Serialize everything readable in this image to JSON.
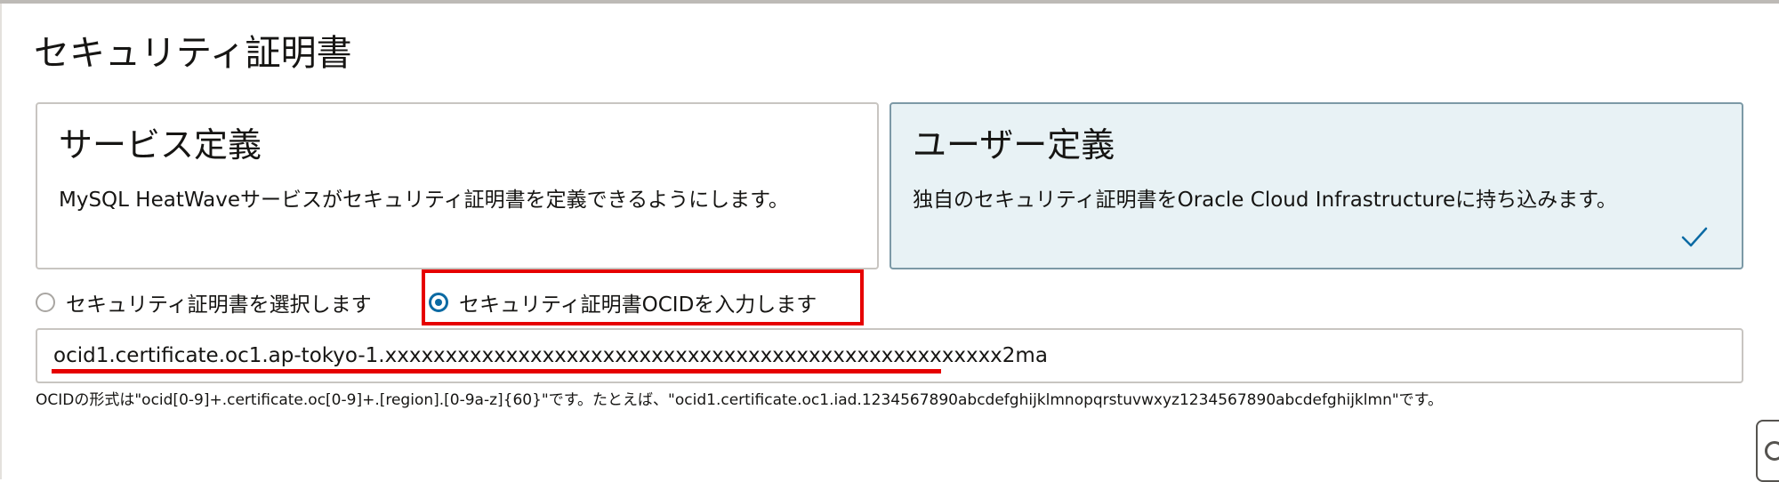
{
  "section": {
    "title": "セキュリティ証明書"
  },
  "cards": [
    {
      "title": "サービス定義",
      "description": "MySQL HeatWaveサービスがセキュリティ証明書を定義できるようにします。",
      "selected": false
    },
    {
      "title": "ユーザー定義",
      "description": "独自のセキュリティ証明書をOracle Cloud Infrastructureに持ち込みます。",
      "selected": true
    }
  ],
  "radios": [
    {
      "label": "セキュリティ証明書を選択します",
      "checked": false
    },
    {
      "label": "セキュリティ証明書OCIDを入力します",
      "checked": true
    }
  ],
  "ocid_field": {
    "value": "ocid1.certificate.oc1.ap-tokyo-1.xxxxxxxxxxxxxxxxxxxxxxxxxxxxxxxxxxxxxxxxxxxxxxxxxxx2ma"
  },
  "hint": "OCIDの形式は\"ocid[0-9]+.certificate.oc[0-9]+.[region].[0-9a-z]{60}\"です。たとえば、\"ocid1.certificate.oc1.iad.1234567890abcdefghijklmnopqrstuvwxyz1234567890abcdefghijklmn\"です。",
  "colors": {
    "accent": "#0b6aa3",
    "selected_card_bg": "#e8f2f5",
    "annotation_red": "#e60000"
  },
  "icons": {
    "selected_check": "check-icon",
    "corner_widget": "help-widget-icon"
  }
}
